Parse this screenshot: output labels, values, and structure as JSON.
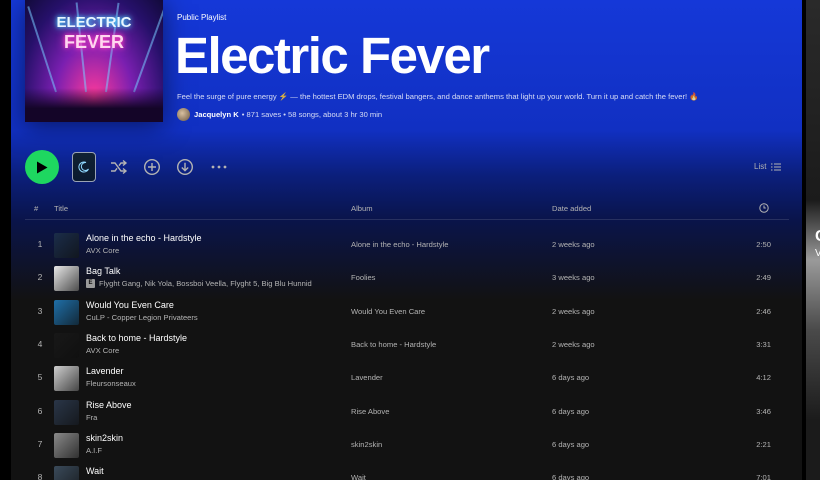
{
  "playlist": {
    "type": "Public Playlist",
    "title": "Electric Fever",
    "description": "Feel the surge of pure energy ⚡ — the hottest EDM drops, festival bangers, and dance anthems that light up your world. Turn it up and catch the fever! 🔥",
    "owner": "Jacquelyn K",
    "stats": "• 871 saves • 58 songs, about 3 hr 30 min",
    "cover_text": [
      "ELECTRIC",
      "FEVER"
    ]
  },
  "actions": {
    "view_label": "List"
  },
  "table": {
    "headers": {
      "num": "#",
      "title": "Title",
      "album": "Album",
      "date_added": "Date added"
    },
    "rows": [
      {
        "num": "1",
        "title": "Alone in the echo - Hardstyle",
        "artist": "AVX Core",
        "album": "Alone in the echo - Hardstyle",
        "date_added": "2 weeks ago",
        "duration": "2:50",
        "explicit": false,
        "thumb": "#1b2d4a"
      },
      {
        "num": "2",
        "title": "Bag Talk",
        "artist": "Flyght Gang, Nik Yola, Bossboi Veella, Flyght 5, Big Blu Hunnid",
        "album": "Foolies",
        "date_added": "3 weeks ago",
        "duration": "2:49",
        "explicit": true,
        "explicit_label": "E",
        "thumb": "#e8e8e8"
      },
      {
        "num": "3",
        "title": "Would You Even Care",
        "artist": "CuLP - Copper Legion Privateers",
        "album": "Would You Even Care",
        "date_added": "2 weeks ago",
        "duration": "2:46",
        "explicit": false,
        "thumb": "#1f6fa8"
      },
      {
        "num": "4",
        "title": "Back to home - Hardstyle",
        "artist": "AVX Core",
        "album": "Back to home - Hardstyle",
        "date_added": "2 weeks ago",
        "duration": "3:31",
        "explicit": false,
        "thumb": "#181818"
      },
      {
        "num": "5",
        "title": "Lavender",
        "artist": "Fleursonseaux",
        "album": "Lavender",
        "date_added": "6 days ago",
        "duration": "4:12",
        "explicit": false,
        "thumb": "#cfcfcf"
      },
      {
        "num": "6",
        "title": "Rise Above",
        "artist": "Fra",
        "album": "Rise Above",
        "date_added": "6 days ago",
        "duration": "3:46",
        "explicit": false,
        "thumb": "#2a3648"
      },
      {
        "num": "7",
        "title": "skin2skin",
        "artist": "A.I.F",
        "album": "skin2skin",
        "date_added": "6 days ago",
        "duration": "2:21",
        "explicit": false,
        "thumb": "#8a8a8a"
      },
      {
        "num": "8",
        "title": "Wait",
        "artist": "",
        "album": "Wait",
        "date_added": "6 days ago",
        "duration": "7:01",
        "explicit": false,
        "thumb": "#3a4a5a"
      }
    ]
  },
  "right_panel": {
    "line1": "C",
    "line2": "V"
  },
  "colors": {
    "accent": "#1ed760",
    "header_blue": "#1538d8",
    "background": "#121212"
  }
}
